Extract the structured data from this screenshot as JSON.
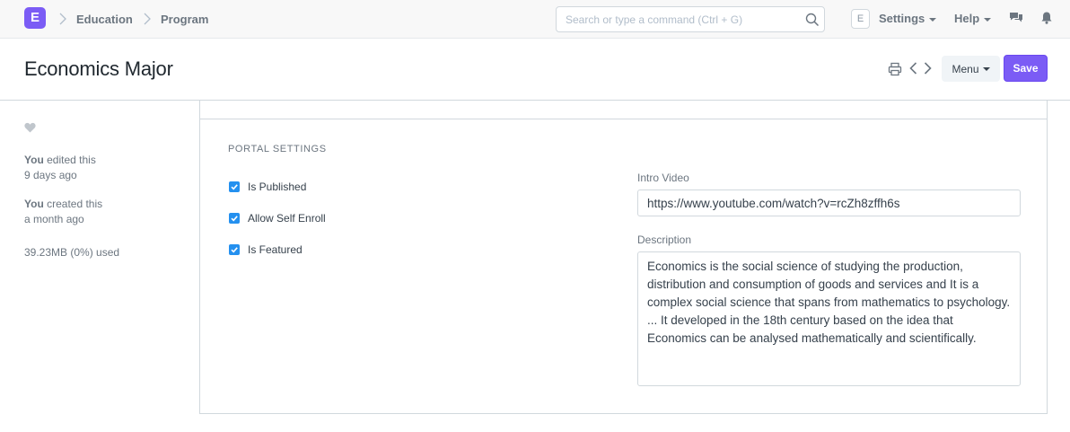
{
  "navbar": {
    "logo_letter": "E",
    "breadcrumbs": [
      "Education",
      "Program"
    ],
    "search_placeholder": "Search or type a command (Ctrl + G)",
    "avatar_letter": "E",
    "settings_label": "Settings",
    "help_label": "Help"
  },
  "page": {
    "title": "Economics Major",
    "menu_label": "Menu",
    "save_label": "Save"
  },
  "sidebar": {
    "edited_by": "You",
    "edited_action": " edited this",
    "edited_time": "9 days ago",
    "created_by": "You",
    "created_action": " created this",
    "created_time": "a month ago",
    "storage_used": "39.23MB (0%) used"
  },
  "form": {
    "section_title": "PORTAL SETTINGS",
    "checkboxes": [
      {
        "label": "Is Published",
        "checked": true
      },
      {
        "label": "Allow Self Enroll",
        "checked": true
      },
      {
        "label": "Is Featured",
        "checked": true
      }
    ],
    "intro_video_label": "Intro Video",
    "intro_video_value": "https://www.youtube.com/watch?v=rcZh8zffh6s",
    "description_label": "Description",
    "description_value": "Economics is the social science of studying the production, distribution and consumption of goods and services and It is a complex social science that spans from mathematics to psychology. ... It developed in the 18th century based on the idea that Economics can be analysed mathematically and scientifically."
  },
  "colors": {
    "brand": "#7b5cf5",
    "checkbox": "#2490ef"
  },
  "icons": [
    "chevron-right-icon",
    "search-icon",
    "chat-icon",
    "bell-icon",
    "printer-icon",
    "chevron-left-icon",
    "heart-icon",
    "check-icon"
  ]
}
